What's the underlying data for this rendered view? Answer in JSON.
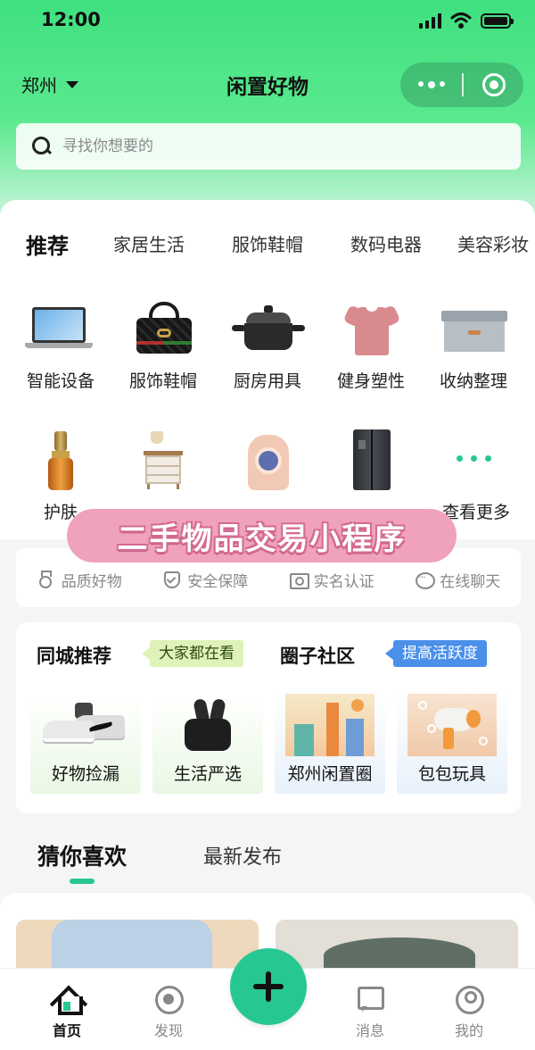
{
  "status_bar": {
    "time": "12:00"
  },
  "header": {
    "city": "郑州",
    "title": "闲置好物",
    "capsule": {
      "more_icon": "more-dots-icon",
      "close_icon": "target-icon"
    }
  },
  "search": {
    "placeholder": "寻找你想要的"
  },
  "category_tabs": [
    "推荐",
    "家居生活",
    "服饰鞋帽",
    "数码电器",
    "美容彩妆"
  ],
  "category_grid": {
    "row1": [
      {
        "label": "智能设备",
        "icon": "laptop"
      },
      {
        "label": "服饰鞋帽",
        "icon": "handbag"
      },
      {
        "label": "厨房用具",
        "icon": "cooking-pot"
      },
      {
        "label": "健身塑性",
        "icon": "t-shirt"
      },
      {
        "label": "收纳整理",
        "icon": "storage-box"
      }
    ],
    "row2": [
      {
        "label": "护肤",
        "icon": "serum-bottle"
      },
      {
        "label": "",
        "icon": "bedside-cabinet"
      },
      {
        "label": "",
        "icon": "pet-backpack"
      },
      {
        "label": "",
        "icon": "refrigerator"
      },
      {
        "label": "查看更多",
        "icon": "more-dots"
      }
    ]
  },
  "overlay_banner": {
    "text": "二手物品交易小程序"
  },
  "guarantees": [
    "品质好物",
    "安全保障",
    "实名认证",
    "在线聊天"
  ],
  "recommend": {
    "local": {
      "title": "同城推荐",
      "badge": "大家都在看"
    },
    "community": {
      "title": "圈子社区",
      "badge": "提高活跃度"
    },
    "tiles": [
      "好物捡漏",
      "生活严选",
      "郑州闲置圈",
      "包包玩具"
    ]
  },
  "feed_tabs": [
    "猜你喜欢",
    "最新发布"
  ],
  "tab_bar": {
    "items": [
      "首页",
      "发现",
      "消息",
      "我的"
    ],
    "fab_icon": "plus-icon"
  },
  "colors": {
    "brand_green": "#27c792",
    "header_gradient_top": "#3fe07f",
    "badge_blue": "#4a90e8",
    "badge_green": "#dff2b8",
    "banner_pink": "#f0a2bc"
  }
}
